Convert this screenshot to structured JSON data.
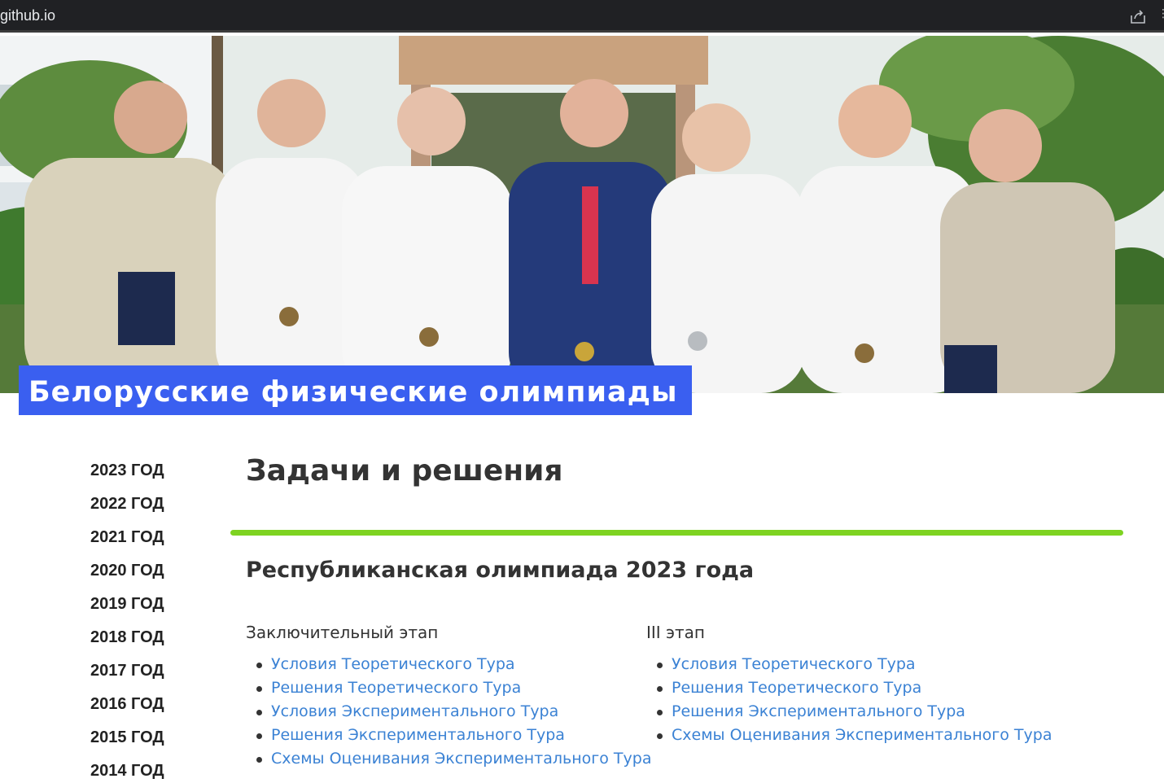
{
  "browser": {
    "url_fragment": "github.io"
  },
  "hero": {
    "site_title": "Белорусские физические олимпиады"
  },
  "sidebar": {
    "years": [
      "2023 ГОД",
      "2022 ГОД",
      "2021 ГОД",
      "2020 ГОД",
      "2019 ГОД",
      "2018 ГОД",
      "2017 ГОД",
      "2016 ГОД",
      "2015 ГОД",
      "2014 ГОД"
    ]
  },
  "main": {
    "page_title": "Задачи и решения",
    "section_title": "Республиканская олимпиада 2023 года",
    "columns": [
      {
        "heading": "Заключительный этап",
        "links": [
          "Условия Теоретического Тура",
          "Решения Теоретического Тура",
          "Условия Экспериментального Тура",
          "Решения Экспериментального Тура",
          "Схемы Оценивания Экспериментального Тура"
        ]
      },
      {
        "heading": "III этап",
        "links": [
          "Условия Теоретического Тура",
          "Решения Теоретического Тура",
          "Решения Экспериментального Тура",
          "Схемы Оценивания Экспериментального Тура"
        ]
      }
    ]
  },
  "colors": {
    "title_bg": "#3a5ff0",
    "rule": "#7ed321",
    "link": "#3b82d4"
  }
}
